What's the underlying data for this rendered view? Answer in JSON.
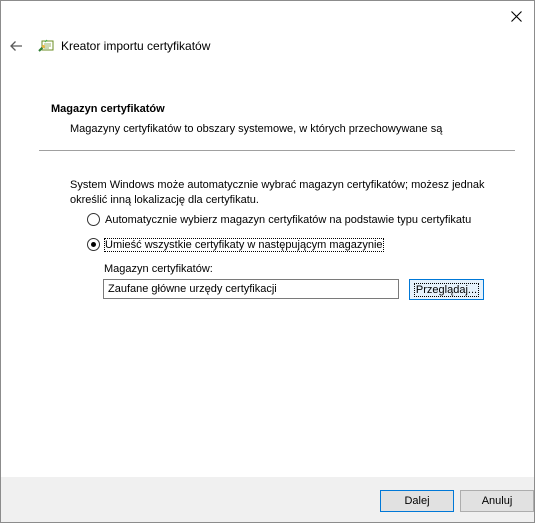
{
  "window": {
    "title": "Kreator importu certyfikatów"
  },
  "icons": {
    "close": "close-icon",
    "back": "back-arrow-icon",
    "wizard": "certificate-wizard-icon"
  },
  "section": {
    "title": "Magazyn certyfikatów",
    "description": "Magazyny certyfikatów to obszary systemowe, w których przechowywane są"
  },
  "intro": "System Windows może automatycznie wybrać magazyn certyfikatów; możesz jednak określić inną lokalizację dla certyfikatu.",
  "options": {
    "auto": {
      "label": "Automatycznie wybierz magazyn certyfikatów na podstawie typu certyfikatu",
      "selected": false
    },
    "manual": {
      "label": "Umieść wszystkie certyfikaty w następującym magazynie",
      "selected": true
    }
  },
  "store": {
    "label": "Magazyn certyfikatów:",
    "value": "Zaufane główne urzędy certyfikacji",
    "browse_label": "Przeglądaj..."
  },
  "footer": {
    "next_label": "Dalej",
    "cancel_label": "Anuluj"
  },
  "colors": {
    "accent": "#0078d7",
    "footer_bg": "#f0f0f0",
    "button_bg": "#e1e1e1",
    "browse_bg": "#e5f1fb"
  }
}
